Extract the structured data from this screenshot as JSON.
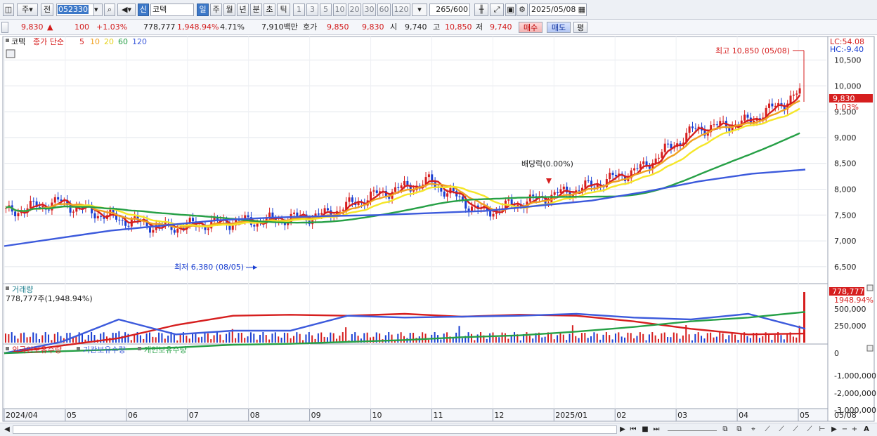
{
  "toolbar": {
    "period_label": "주",
    "prev_label": "전",
    "code": "052330",
    "credit_label": "신",
    "name": "코텍",
    "tf_buttons": [
      "일",
      "주",
      "월",
      "년",
      "분",
      "초",
      "틱"
    ],
    "active_tf": "일",
    "n_buttons": [
      "1",
      "3",
      "5",
      "10",
      "20",
      "30",
      "60",
      "120"
    ],
    "count": "265",
    "count_total": "/600",
    "date": "2025/05/08"
  },
  "info": {
    "price": "9,830",
    "change_arrow": "▲",
    "change": "100",
    "change_pct": "+1.03%",
    "volume": "778,777",
    "volume_pct": "1,948.94%",
    "turnover": "4.71%",
    "amount": "7,910백만",
    "ask_label": "호가",
    "ask1": "9,850",
    "ask2": "9,830",
    "open_label": "시",
    "open": "9,740",
    "high_label": "고",
    "high": "10,850",
    "low_label": "저",
    "low": "9,740",
    "buy_label": "매수",
    "sell_label": "매도",
    "avg_label": "평"
  },
  "legend": {
    "name": "코텍",
    "ma_title": "종가 단순",
    "ma_periods": [
      "5",
      "10",
      "20",
      "60",
      "120"
    ],
    "ma_colors": [
      "#d61e1e",
      "#f0a020",
      "#f5e628",
      "#26a046",
      "#3c5adc"
    ]
  },
  "annotations": {
    "lc": "LC:54.08",
    "hc": "HC:-9.40",
    "high_note": "최고 10,850 (05/08)",
    "low_note": "최저 6,380 (08/05)",
    "dividend_note": "배당락(0.00%)",
    "last_price_tag": "9,830",
    "last_pct_tag": "1.03%"
  },
  "volume_panel": {
    "title": "거래량",
    "subtitle": "778,777주(1,948.94%)",
    "last_tag": "778,777",
    "last_pct_tag": "1948.94%"
  },
  "holdings_panel": {
    "series_names": [
      "외국인보유수량",
      "기관보유수량",
      "개인보유수량"
    ],
    "series_colors": [
      "#d61e1e",
      "#3c5adc",
      "#26a046"
    ]
  },
  "colors": {
    "up": "#d61e1e",
    "down": "#1a3fd2",
    "accent": "#3c78c8"
  },
  "chart_data": {
    "type": "line",
    "title": "",
    "price": {
      "x": [
        "2024/04",
        "05",
        "06",
        "07",
        "08",
        "09",
        "10",
        "11",
        "12",
        "2025/01",
        "02",
        "03",
        "04",
        "05"
      ],
      "close": [
        7550,
        7750,
        7450,
        7250,
        7350,
        7400,
        7500,
        7900,
        8150,
        7550,
        7800,
        8050,
        8400,
        9150,
        9300,
        9850
      ],
      "close_dates": [
        "2024/04",
        "2024/05",
        "2024/06",
        "2024/07",
        "2024/08",
        "2024/08/05",
        "2024/09",
        "2024/10",
        "2024/11",
        "2024/11/15",
        "2024/12",
        "2025/01",
        "2025/02",
        "2025/03",
        "2025/04",
        "2025/05/08"
      ],
      "ma120": [
        6900,
        7050,
        7200,
        7300,
        7400,
        7450,
        7480,
        7500,
        7540,
        7580,
        7680,
        7780,
        7950,
        8150,
        8300,
        8380
      ],
      "ylim": [
        6200,
        10900
      ],
      "yticks": [
        6500,
        7000,
        7500,
        8000,
        8500,
        9000,
        9500,
        10000,
        10500
      ],
      "ytick_labels": [
        "6,500",
        "7,000",
        "7,500",
        "8,000",
        "8,500",
        "9,000",
        "9,500",
        "10,000",
        "10,500"
      ],
      "high": 10850,
      "low": 6380,
      "last": 9830
    },
    "volume": {
      "yticks": [
        "250,000",
        "500,000"
      ],
      "last": 778777
    },
    "holdings": {
      "yticks": [
        "0",
        "-1,000,000",
        "-2,000,000",
        "-3,000,000"
      ]
    },
    "x_labels": [
      "2024/04",
      "05",
      "06",
      "07",
      "08",
      "09",
      "10",
      "11",
      "12",
      "2025/01",
      "02",
      "03",
      "04",
      "05"
    ],
    "x_end_label": "05/08"
  }
}
